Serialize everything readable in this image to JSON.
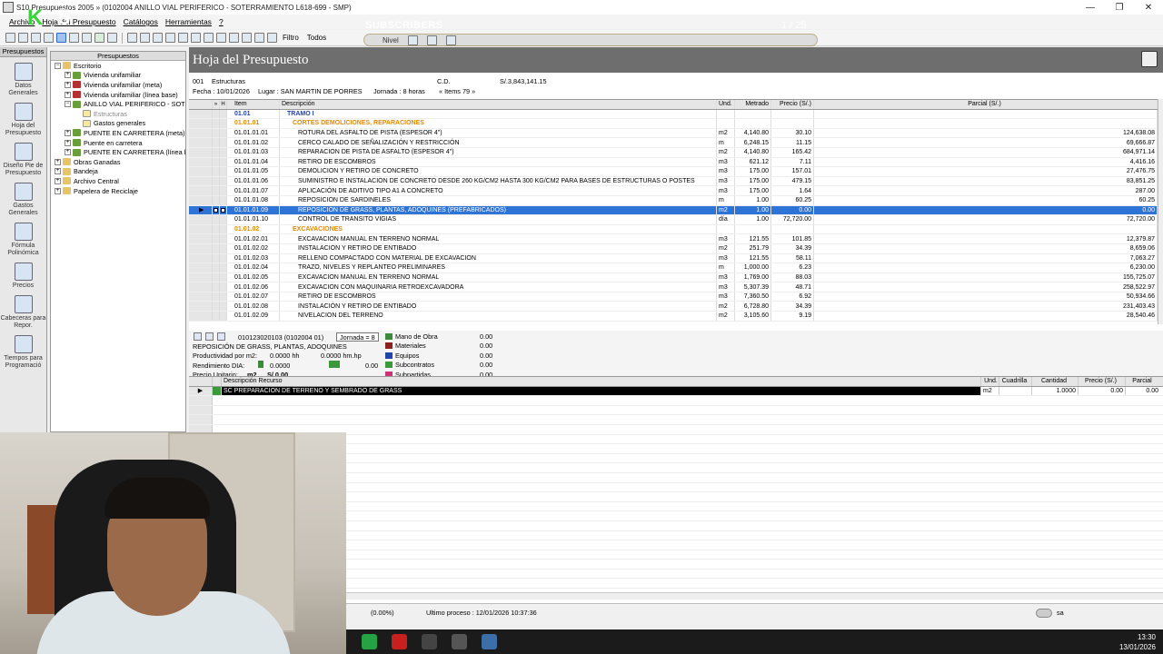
{
  "window": {
    "title": "S10 Presupuestos 2005 » (0102004 ANILLO VIAL PERIFERICO - SOTERRAMIENTO L618-699 - SMP)",
    "buttons": [
      "—",
      "❐",
      "✕"
    ]
  },
  "menu": [
    "Archivo",
    "Hoja del Presupuesto",
    "Catálogos",
    "Herramientas",
    "?"
  ],
  "toolbar": {
    "filter_label": "Filtro",
    "filter_value": "Todos",
    "nivel_label": "Nivel"
  },
  "overlay": {
    "subscribers": "SUBSCRIBERS",
    "counter": "1 / 25"
  },
  "logo": {
    "left": "K",
    "right": "5"
  },
  "rail": {
    "header": "Presupuestos",
    "items": [
      {
        "label": "Datos Generales",
        "icon": "diamond-icon"
      },
      {
        "label": "Hoja del Presupuesto",
        "icon": "sheet-icon"
      },
      {
        "label": "Diseño Pie de Presupuesto",
        "icon": "design-icon"
      },
      {
        "label": "Gastos Generales",
        "icon": "books-icon"
      },
      {
        "label": "Fórmula Polinómica",
        "icon": "fx-icon"
      },
      {
        "label": "Precios",
        "icon": "prices-icon"
      },
      {
        "label": "Cabeceras para Repor.",
        "icon": "note-icon"
      },
      {
        "label": "Tiempos para Programació",
        "icon": "clock-icon"
      }
    ]
  },
  "tree": {
    "header": "Presupuestos",
    "rows": [
      {
        "label": "Escritorio",
        "indent": 0,
        "toggle": "−",
        "icon": "folder"
      },
      {
        "label": "Vivienda unifamiliar",
        "indent": 1,
        "toggle": "+",
        "icon": "green"
      },
      {
        "label": "Vivienda unifamiliar (meta)",
        "indent": 1,
        "toggle": "+",
        "icon": "red"
      },
      {
        "label": "Vivienda unifamiliar (línea base)",
        "indent": 1,
        "toggle": "+",
        "icon": "red"
      },
      {
        "label": "ANILLO VIAL PERIFERICO - SOTE",
        "indent": 1,
        "toggle": "−",
        "icon": "green"
      },
      {
        "label": "Estructuras",
        "indent": 2,
        "toggle": "",
        "icon": "doc",
        "muted": true
      },
      {
        "label": "Gastos generales",
        "indent": 2,
        "toggle": "",
        "icon": "doc"
      },
      {
        "label": "PUENTE EN CARRETERA (meta)",
        "indent": 1,
        "toggle": "+",
        "icon": "green"
      },
      {
        "label": "Puente en carretera",
        "indent": 1,
        "toggle": "+",
        "icon": "green"
      },
      {
        "label": "PUENTE EN CARRETERA (línea b",
        "indent": 1,
        "toggle": "+",
        "icon": "green"
      },
      {
        "label": "Obras Ganadas",
        "indent": 0,
        "toggle": "+",
        "icon": "folder"
      },
      {
        "label": "Bandeja",
        "indent": 0,
        "toggle": "+",
        "icon": "folder"
      },
      {
        "label": "Archivo Central",
        "indent": 0,
        "toggle": "+",
        "icon": "folder"
      },
      {
        "label": "Papelera de Reciclaje",
        "indent": 0,
        "toggle": "+",
        "icon": "folder"
      }
    ]
  },
  "sheet": {
    "title": "Hoja del Presupuesto",
    "code": "001",
    "name": "Estructuras",
    "cd_label": "C.D.",
    "cd_value": "S/.3,843,141.15",
    "fecha": "Fecha : 10/01/2026",
    "lugar": "Lugar : SAN MARTIN DE PORRES",
    "jornada": "Jornada : 8 horas",
    "items": "« Items 79 »"
  },
  "grid": {
    "headers": {
      "m": "»",
      "h": "H",
      "item": "Item",
      "desc": "Descripción",
      "und": "Und.",
      "met": "Metrado",
      "pre": "Precio (S/.)",
      "par": "Parcial (S/.)"
    },
    "rows": [
      {
        "item": "01.01",
        "desc": "TRAMO I",
        "und": "",
        "met": "",
        "pre": "",
        "par": "",
        "lv": 0
      },
      {
        "item": "01.01.01",
        "desc": "CORTES DEMOLICIONES, REPARACIONES",
        "und": "",
        "met": "",
        "pre": "",
        "par": "",
        "lv": 1
      },
      {
        "item": "01.01.01.01",
        "desc": "ROTURA DEL ASFALTO DE PISTA (ESPESOR 4\")",
        "und": "m2",
        "met": "4,140.80",
        "pre": "30.10",
        "par": "124,638.08",
        "lv": 2
      },
      {
        "item": "01.01.01.02",
        "desc": "CERCO CALADO DE SEÑALIZACIÓN Y RESTRICCIÓN",
        "und": "m",
        "met": "6,248.15",
        "pre": "11.15",
        "par": "69,666.87",
        "lv": 2
      },
      {
        "item": "01.01.01.03",
        "desc": "REPARACION DE PISTA DE ASFALTO (ESPESOR 4\")",
        "und": "m2",
        "met": "4,140.80",
        "pre": "165.42",
        "par": "684,971.14",
        "lv": 2
      },
      {
        "item": "01.01.01.04",
        "desc": "RETIRO DE ESCOMBROS",
        "und": "m3",
        "met": "621.12",
        "pre": "7.11",
        "par": "4,416.16",
        "lv": 2
      },
      {
        "item": "01.01.01.05",
        "desc": "DEMOLICION Y RETIRO DE CONCRETO",
        "und": "m3",
        "met": "175.00",
        "pre": "157.01",
        "par": "27,476.75",
        "lv": 2
      },
      {
        "item": "01.01.01.06",
        "desc": "SUMINISTRO E INSTALACIÓN DE CONCRETO DESDE 260 KG/CM2 HASTA 300 KG/CM2 PARA BASES DE ESTRUCTURAS O POSTES",
        "und": "m3",
        "met": "175.00",
        "pre": "479.15",
        "par": "83,851.25",
        "lv": 2
      },
      {
        "item": "01.01.01.07",
        "desc": "APLICACIÓN DE ADITIVO TIPO A1 A CONCRETO",
        "und": "m3",
        "met": "175.00",
        "pre": "1.64",
        "par": "287.00",
        "lv": 2
      },
      {
        "item": "01.01.01.08",
        "desc": "REPOSICIÓN DE SARDINELES",
        "und": "m",
        "met": "1.00",
        "pre": "60.25",
        "par": "60.25",
        "lv": 2
      },
      {
        "item": "01.01.01.09",
        "desc": "REPOSICIÓN DE GRASS, PLANTAS, ADOQUINES (PREFABRICADOS)",
        "und": "m2",
        "met": "1.00",
        "pre": "0.00",
        "par": "0.00",
        "lv": 2,
        "sel": true
      },
      {
        "item": "01.01.01.10",
        "desc": "CONTROL DE TRANSITO VIGIAS",
        "und": "día",
        "met": "1.00",
        "pre": "72,720.00",
        "par": "72,720.00",
        "lv": 2
      },
      {
        "item": "01.01.02",
        "desc": "EXCAVACIONES",
        "und": "",
        "met": "",
        "pre": "",
        "par": "",
        "lv": 1
      },
      {
        "item": "01.01.02.01",
        "desc": "EXCAVACION MANUAL EN TERRENO NORMAL",
        "und": "m3",
        "met": "121.55",
        "pre": "101.85",
        "par": "12,379.87",
        "lv": 2
      },
      {
        "item": "01.01.02.02",
        "desc": "INSTALACIÓN Y RETIRO DE ENTIBADO",
        "und": "m2",
        "met": "251.79",
        "pre": "34.39",
        "par": "8,659.06",
        "lv": 2
      },
      {
        "item": "01.01.02.03",
        "desc": "RELLENO COMPACTADO CON MATERIAL DE EXCAVACIÓN",
        "und": "m3",
        "met": "121.55",
        "pre": "58.11",
        "par": "7,063.27",
        "lv": 2
      },
      {
        "item": "01.01.02.04",
        "desc": "TRAZO, NIVELES Y REPLANTEO PRELIMINARES",
        "und": "m",
        "met": "1,000.00",
        "pre": "6.23",
        "par": "6,230.00",
        "lv": 2
      },
      {
        "item": "01.01.02.05",
        "desc": "EXCAVACION MANUAL EN TERRENO NORMAL",
        "und": "m3",
        "met": "1,769.00",
        "pre": "88.03",
        "par": "155,725.07",
        "lv": 2
      },
      {
        "item": "01.01.02.06",
        "desc": "EXCAVACION CON MAQUINARIA RETROEXCAVADORA",
        "und": "m3",
        "met": "5,307.39",
        "pre": "48.71",
        "par": "258,522.97",
        "lv": 2
      },
      {
        "item": "01.01.02.07",
        "desc": "RETIRO DE ESCOMBROS",
        "und": "m3",
        "met": "7,360.50",
        "pre": "6.92",
        "par": "50,934.66",
        "lv": 2
      },
      {
        "item": "01.01.02.08",
        "desc": "INSTALACIÓN Y RETIRO DE ENTIBADO",
        "und": "m2",
        "met": "6,728.80",
        "pre": "34.39",
        "par": "231,403.43",
        "lv": 2
      },
      {
        "item": "01.01.02.09",
        "desc": "NIVELACION DEL TERRENO",
        "und": "m2",
        "met": "3,105.60",
        "pre": "9.19",
        "par": "28,540.46",
        "lv": 2
      }
    ]
  },
  "detail": {
    "code": "010123020103 (0102004 01)",
    "jornada": "Jornada = 8",
    "name": "REPOSICIÓN DE GRASS, PLANTAS, ADOQUINES",
    "productividad_label": "Productividad por m2:",
    "prod_hh": "0.0000 hh",
    "prod_hm": "0.0000 hm.hp",
    "rend_label": "Rendimiento DIA:",
    "rend_value": "0.0000",
    "rend_right": "0.00",
    "pu_label": "Precio Unitario:",
    "pu_und": "m2",
    "pu_value": "S/.0.00",
    "resources": [
      {
        "label": "Mano de Obra",
        "value": "0.00",
        "color": "#3a8a3a"
      },
      {
        "label": "Materiales",
        "value": "0.00",
        "color": "#8a2020"
      },
      {
        "label": "Equipos",
        "value": "0.00",
        "color": "#2244aa"
      },
      {
        "label": "Subcontratos",
        "value": "0.00",
        "color": "#3a9a3a"
      },
      {
        "label": "Subpartidas",
        "value": "0.00",
        "color": "#cc3377"
      }
    ]
  },
  "res_grid": {
    "headers": {
      "desc": "Descripción Recurso",
      "und": "Und.",
      "cua": "Cuadrilla",
      "can": "Cantidad",
      "pre": "Precio (S/.)",
      "par": "Parcial"
    },
    "rows": [
      {
        "desc": "SC PREPARACION DE TERRENO Y SEMBRADO DE GRASS",
        "und": "m2",
        "cua": "",
        "can": "1.0000",
        "pre": "0.00",
        "par": "0.00"
      }
    ]
  },
  "status": {
    "percent": "(0.00%)",
    "last": "Ultimo proceso : 12/01/2026 10:37:36",
    "tray": "sa"
  },
  "taskbar": {
    "time": "13:30",
    "date": "13/01/2026"
  }
}
